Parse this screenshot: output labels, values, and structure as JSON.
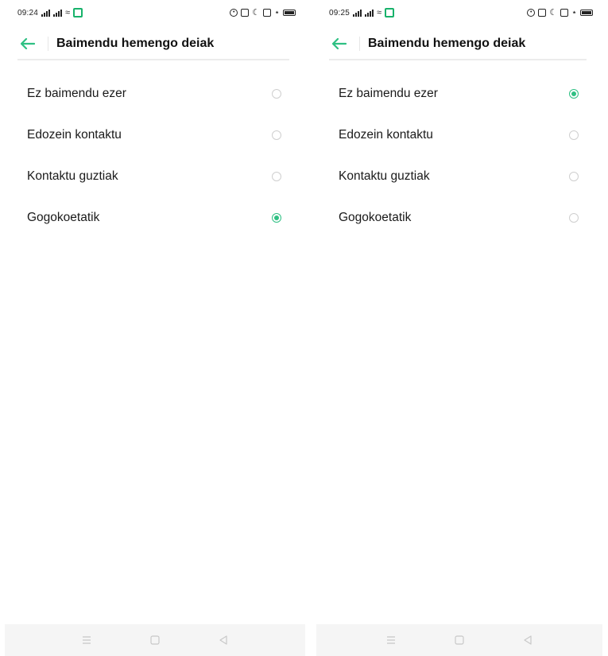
{
  "screens": [
    {
      "status": {
        "time": "09:24"
      },
      "header": {
        "title": "Baimendu hemengo deiak"
      },
      "options": [
        {
          "label": "Ez baimendu ezer",
          "selected": false
        },
        {
          "label": "Edozein kontaktu",
          "selected": false
        },
        {
          "label": "Kontaktu guztiak",
          "selected": false
        },
        {
          "label": "Gogokoetatik",
          "selected": true
        }
      ]
    },
    {
      "status": {
        "time": "09:25"
      },
      "header": {
        "title": "Baimendu hemengo deiak"
      },
      "options": [
        {
          "label": "Ez baimendu ezer",
          "selected": true
        },
        {
          "label": "Edozein kontaktu",
          "selected": false
        },
        {
          "label": "Kontaktu guztiak",
          "selected": false
        },
        {
          "label": "Gogokoetatik",
          "selected": false
        }
      ]
    }
  ],
  "colors": {
    "accent": "#2fc083",
    "divider": "#ececec",
    "navbar_bg": "#f5f5f5"
  },
  "icons": {
    "back": "arrow-left-icon",
    "nav_menu": "menu-icon",
    "nav_home": "square-icon",
    "nav_back": "triangle-back-icon"
  }
}
